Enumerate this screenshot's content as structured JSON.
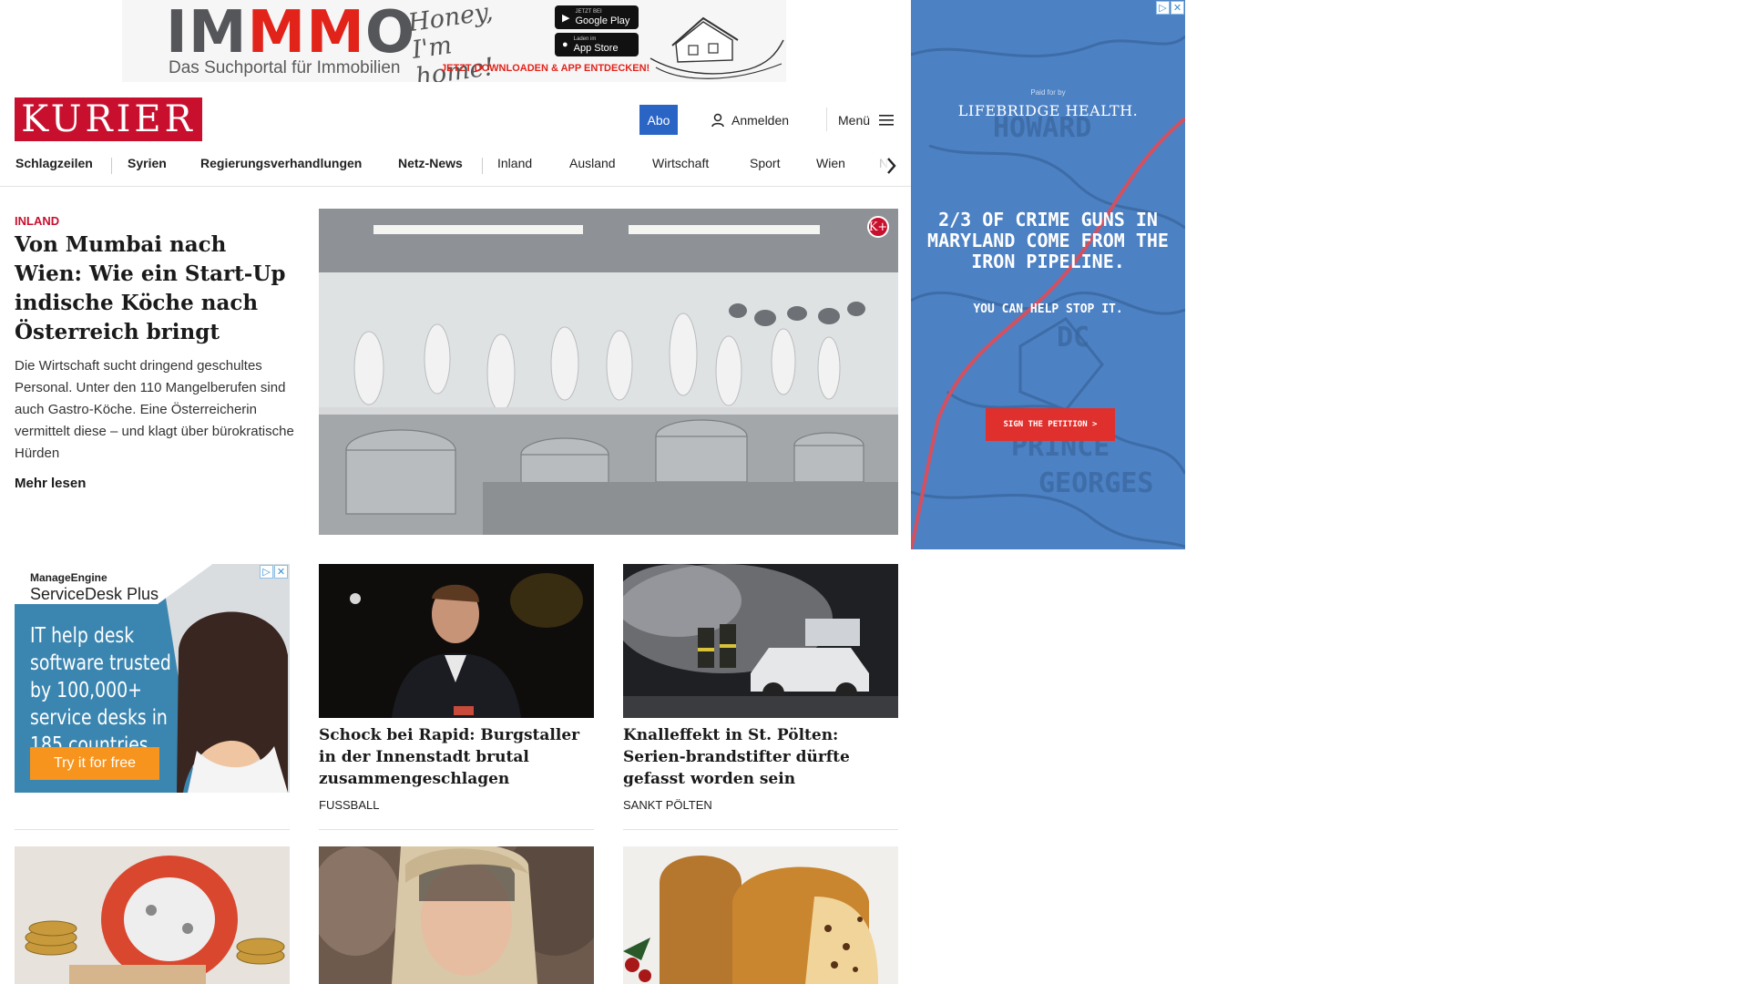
{
  "banner_ad": {
    "logo_pre": "IM",
    "logo_mid": "MM",
    "logo_post": "O",
    "tagline": "Das Suchportal für Immobilien",
    "script_text": "Honey, I'm home!",
    "google_small": "JETZT BEI",
    "google_label": "Google Play",
    "apple_small": "Laden im",
    "apple_label": "App Store",
    "cta": "JETZT DOWNLOADEN & APP ENTDECKEN!"
  },
  "header": {
    "logo": "KURIER",
    "abo_label": "Abo",
    "login_label": "Anmelden",
    "menu_label": "Menü"
  },
  "nav": {
    "items": [
      {
        "label": "Schlagzeilen"
      },
      {
        "label": "Syrien"
      },
      {
        "label": "Regierungsverhandlungen"
      },
      {
        "label": "Netz-News"
      },
      {
        "label": "Inland"
      },
      {
        "label": "Ausland"
      },
      {
        "label": "Wirtschaft"
      },
      {
        "label": "Sport"
      },
      {
        "label": "Wien"
      },
      {
        "label": "Ni"
      }
    ]
  },
  "hero": {
    "kicker": "INLAND",
    "title": "Von Mumbai nach Wien: Wie ein Start-Up indische Köche nach Österreich bringt",
    "text": "Die Wirtschaft sucht dringend geschultes Personal. Unter den 110 Mangelberufen sind auch Gastro-Köche. Eine Österreicherin vermittelt diese – und klagt über bürokratische Hürden",
    "more": "Mehr lesen",
    "badge": "K+"
  },
  "ad_left": {
    "brand": "ManageEngine",
    "product": "ServiceDesk Plus",
    "headline": "IT help desk software trusted by 100,000+ service desks in 185 countries",
    "cta": "Try it for free"
  },
  "cards": [
    {
      "title": "Schock bei Rapid: Burgstaller in der Innenstadt brutal zusammengeschlagen",
      "tag": "FUSSBALL"
    },
    {
      "title": "Knalleffekt in St. Pölten: Serien-brandstifter dürfte gefasst worden sein",
      "tag": "SANKT PÖLTEN"
    }
  ],
  "ad_right": {
    "paid": "Paid for by",
    "brand": "LIFEBRIDGE HEALTH.",
    "headline": "2/3 OF CRIME GUNS IN MARYLAND COME FROM THE IRON PIPELINE.",
    "sub": "YOU CAN HELP STOP IT.",
    "cta": "SIGN THE PETITION >",
    "map_labels": [
      "HOWARD",
      "DC",
      "PRINCE GEORGES"
    ]
  },
  "colors": {
    "brand_red": "#c8102e",
    "abo_blue": "#2a64c5",
    "ad_orange": "#f7941d"
  }
}
